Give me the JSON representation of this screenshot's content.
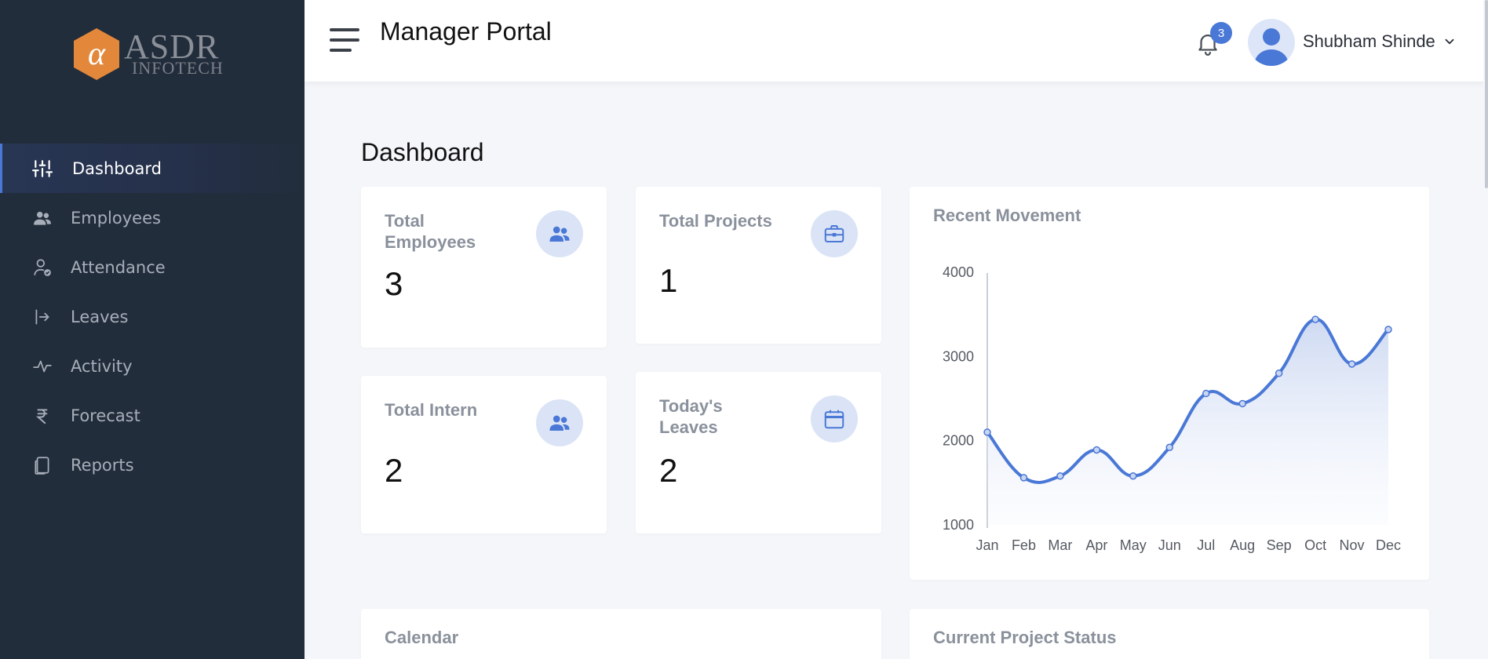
{
  "brand": {
    "logo_letter": "α",
    "logo_text": "ASDR",
    "logo_subtext": "INFOTECH",
    "logo_color": "#e3883a"
  },
  "sidebar": {
    "items": [
      {
        "label": "Dashboard",
        "icon": "sliders-icon",
        "active": true
      },
      {
        "label": "Employees",
        "icon": "users-icon",
        "active": false
      },
      {
        "label": "Attendance",
        "icon": "user-check-icon",
        "active": false
      },
      {
        "label": "Leaves",
        "icon": "log-out-icon",
        "active": false
      },
      {
        "label": "Activity",
        "icon": "activity-icon",
        "active": false
      },
      {
        "label": "Forecast",
        "icon": "rupee-icon",
        "active": false
      },
      {
        "label": "Reports",
        "icon": "copy-icon",
        "active": false
      }
    ]
  },
  "header": {
    "title": "Manager Portal",
    "notification_count": "3",
    "user_name": "Shubham Shinde"
  },
  "main": {
    "page_title": "Dashboard",
    "stats": [
      {
        "label": "Total Employees",
        "value": "3",
        "icon": "users-icon"
      },
      {
        "label": "Total Projects",
        "value": "1",
        "icon": "briefcase-icon"
      },
      {
        "label": "Total Intern",
        "value": "2",
        "icon": "users-icon"
      },
      {
        "label": "Today's Leaves",
        "value": "2",
        "icon": "calendar-icon"
      }
    ],
    "chart_title": "Recent Movement",
    "bottom_cards": {
      "calendar_title": "Calendar",
      "project_status_title": "Current Project Status"
    }
  },
  "colors": {
    "accent": "#4a78d6",
    "sidebar_bg": "#222d3c",
    "page_bg": "#f4f6fa"
  },
  "chart_data": {
    "type": "area",
    "categories": [
      "Jan",
      "Feb",
      "Mar",
      "Apr",
      "May",
      "Jun",
      "Jul",
      "Aug",
      "Sep",
      "Oct",
      "Nov",
      "Dec"
    ],
    "values": [
      2100,
      1560,
      1580,
      1890,
      1580,
      1920,
      2560,
      2440,
      2800,
      3440,
      2910,
      3320
    ],
    "yticks": [
      1000,
      2000,
      3000,
      4000
    ],
    "ylim": [
      1000,
      4000
    ],
    "title": "Recent Movement",
    "xlabel": "",
    "ylabel": "",
    "grid": false
  }
}
